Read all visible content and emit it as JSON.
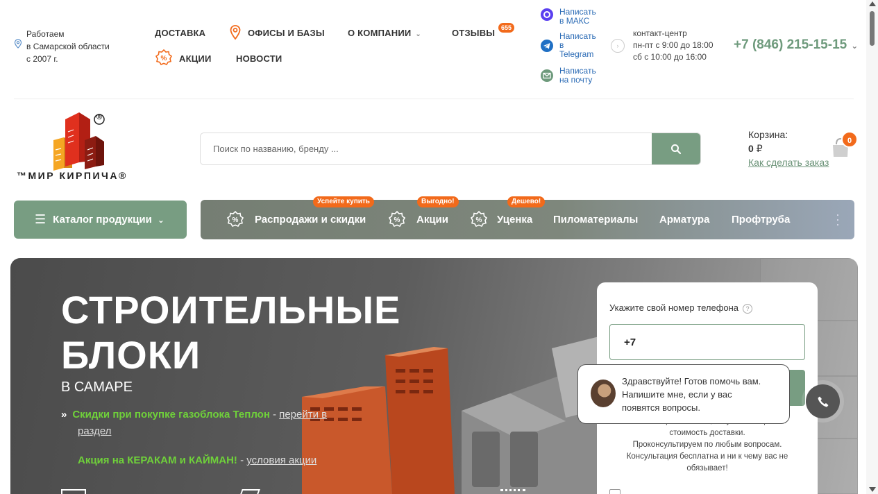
{
  "topbar": {
    "work_line1": "Работаем",
    "work_line2": "в Самарской области",
    "work_line3": "с 2007 г.",
    "nav": {
      "delivery": "ДОСТАВКА",
      "offices": "ОФИСЫ И БАЗЫ",
      "about": "О КОМПАНИИ",
      "reviews": "ОТЗЫВЫ",
      "reviews_count": "655",
      "promos": "АКЦИИ",
      "news": "НОВОСТИ"
    },
    "messengers": {
      "max_line1": "Написать",
      "max_line2": "в МАКС",
      "tg_line1": "Написать",
      "tg_line2": "в",
      "tg_line3": "Telegram",
      "mail_line1": "Написать",
      "mail_line2": "на почту"
    },
    "contact": {
      "line1": "контакт-центр",
      "line2": "пн-пт с 9:00 до 18:00",
      "line3": "сб с 10:00 до 16:00",
      "phone": "+7 (846) 215-15-15"
    }
  },
  "header": {
    "logo_text": "™МИР КИРПИЧА®",
    "logo_reg": "®",
    "search_placeholder": "Поиск по названию, бренду ...",
    "cart_label": "Корзина:",
    "cart_amount": "0",
    "cart_currency": "₽",
    "cart_how": "Как сделать заказ",
    "cart_count": "0"
  },
  "navbar": {
    "catalog": "Каталог продукции",
    "items": [
      {
        "label": "Распродажи и скидки",
        "tag": "Успейте купить"
      },
      {
        "label": "Акции",
        "tag": "Выгодно!"
      },
      {
        "label": "Уценка",
        "tag": "Дешево!"
      },
      {
        "label": "Пиломатериалы"
      },
      {
        "label": "Арматура"
      },
      {
        "label": "Профтруба"
      }
    ]
  },
  "hero": {
    "title_line1": "СТРОИТЕЛЬНЫЕ",
    "title_line2": "БЛОКИ",
    "subtitle": "В САМАРЕ",
    "link1_text": "Скидки при покупке газоблока Теплон",
    "link1_dash": " - ",
    "link1_action_1": "перейти в",
    "link1_action_2": "раздел",
    "link2_text": "Акция на КЕРАКАМ и КАЙМАН!",
    "link2_dash": " - ",
    "link2_action": "условия акции"
  },
  "form": {
    "label": "Укажите свой номер телефона",
    "help": "?",
    "phone_value": "+7",
    "note_line1": "Мы сообщим наличие, актуальные цены и",
    "note_line2": "стоимость доставки.",
    "note_line3": "Проконсультируем по любым вопросам.",
    "note_line4": "Консультация бесплатна и ни к чему вас не",
    "note_line5": "обязывает!"
  },
  "chat": {
    "line1": "Здравствуйте! Готов помочь вам.",
    "line2": "Напишите мне, если у вас",
    "line3": "появятся вопросы."
  },
  "colors": {
    "accent_green": "#789d82",
    "phone_green": "#6e9a7c",
    "badge_orange": "#f26a1b",
    "link_blue": "#2b6bb5",
    "promo_green": "#6fd13a"
  }
}
